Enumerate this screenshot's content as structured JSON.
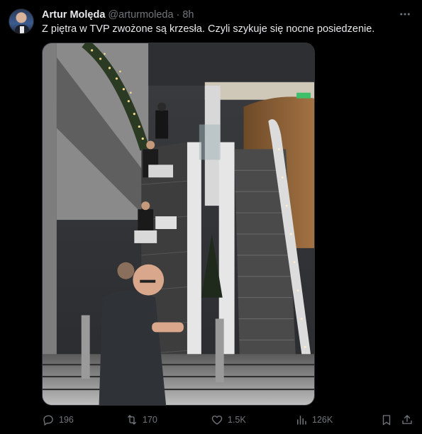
{
  "author": {
    "name": "Artur Molęda",
    "handle": "@arturmoleda",
    "separator": "·",
    "time": "8h"
  },
  "tweet": {
    "text": "Z piętra w TVP zwożone są krzesła. Czyli szykuje się nocne posiedzenie."
  },
  "actions": {
    "replies": "196",
    "retweets": "170",
    "likes": "1.5K",
    "views": "126K"
  },
  "icons": {
    "more": "more-horizontal-icon",
    "reply": "reply-icon",
    "retweet": "retweet-icon",
    "like": "heart-icon",
    "views": "views-icon",
    "bookmark": "bookmark-icon",
    "share": "share-icon"
  },
  "colors": {
    "background": "#000000",
    "text": "#e7e9ea",
    "muted": "#71767b",
    "border": "#2f3336"
  }
}
